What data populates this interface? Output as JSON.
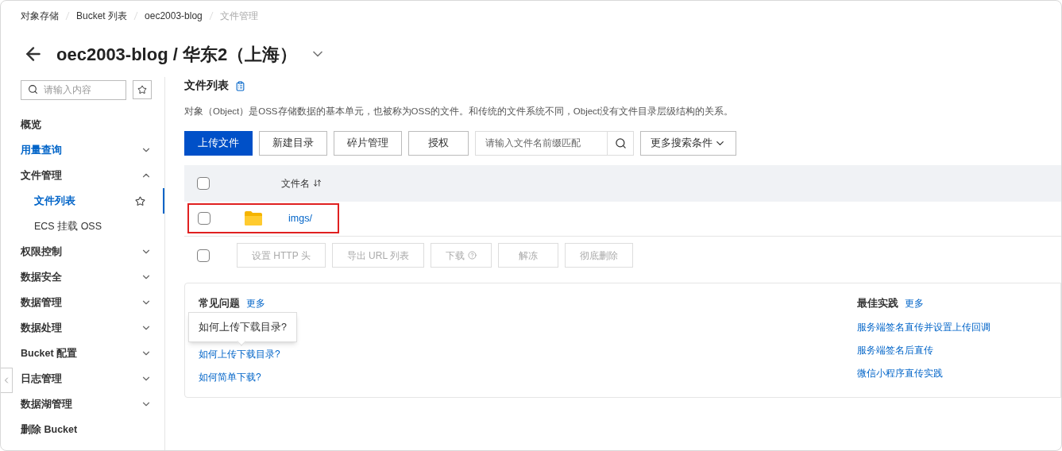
{
  "breadcrumb": [
    {
      "label": "对象存储",
      "current": false
    },
    {
      "label": "Bucket 列表",
      "current": false
    },
    {
      "label": "oec2003-blog",
      "current": false
    },
    {
      "label": "文件管理",
      "current": true
    }
  ],
  "page_title": "oec2003-blog / 华东2（上海）",
  "sidebar": {
    "search": {
      "placeholder": "请输入内容"
    },
    "items": [
      {
        "kind": "link",
        "label": "概览",
        "highlighted": false
      },
      {
        "kind": "group",
        "label": "用量查询",
        "highlighted": true,
        "expanded": false
      },
      {
        "kind": "group",
        "label": "文件管理",
        "highlighted": false,
        "expanded": true,
        "children": [
          {
            "label": "文件列表",
            "selected": true
          },
          {
            "label": "ECS 挂载 OSS",
            "selected": false
          }
        ]
      },
      {
        "kind": "group",
        "label": "权限控制",
        "highlighted": false,
        "expanded": false
      },
      {
        "kind": "group",
        "label": "数据安全",
        "highlighted": false,
        "expanded": false
      },
      {
        "kind": "group",
        "label": "数据管理",
        "highlighted": false,
        "expanded": false
      },
      {
        "kind": "group",
        "label": "数据处理",
        "highlighted": false,
        "expanded": false
      },
      {
        "kind": "group",
        "label": "Bucket 配置",
        "highlighted": false,
        "expanded": false
      },
      {
        "kind": "group",
        "label": "日志管理",
        "highlighted": false,
        "expanded": false
      },
      {
        "kind": "group",
        "label": "数据湖管理",
        "highlighted": false,
        "expanded": false
      },
      {
        "kind": "link",
        "label": "删除 Bucket",
        "highlighted": false
      }
    ]
  },
  "section": {
    "title": "文件列表",
    "description": "对象（Object）是OSS存储数据的基本单元，也被称为OSS的文件。和传统的文件系统不同，Object没有文件目录层级结构的关系。"
  },
  "toolbar": {
    "buttons": [
      {
        "label": "上传文件",
        "primary": true
      },
      {
        "label": "新建目录",
        "primary": false
      },
      {
        "label": "碎片管理",
        "primary": false
      },
      {
        "label": "授权",
        "primary": false
      }
    ],
    "search": {
      "placeholder": "请输入文件名前缀匹配"
    },
    "filter": "更多搜索条件"
  },
  "table": {
    "columns": [
      {
        "label": "文件名"
      }
    ],
    "header_checked": false,
    "rows": [
      {
        "kind": "folder",
        "name": "imgs/",
        "checked": false,
        "outlined": true
      }
    ],
    "bulk_checked": false,
    "bulk_actions": [
      {
        "label": "设置 HTTP 头",
        "disabled": true,
        "help": false
      },
      {
        "label": "导出 URL 列表",
        "disabled": true,
        "help": false
      },
      {
        "label": "下载",
        "disabled": true,
        "help": true
      },
      {
        "label": "解冻",
        "disabled": true,
        "help": false
      },
      {
        "label": "彻底删除",
        "disabled": true,
        "help": false
      }
    ]
  },
  "faq": {
    "title": "常见问题",
    "more": "更多",
    "tooltip": "如何上传下载目录?",
    "links": [
      "如何上传下载目录?",
      "如何简单下载?"
    ]
  },
  "best_practice": {
    "title": "最佳实践",
    "more": "更多",
    "links": [
      "服务端签名直传并设置上传回调",
      "服务端签名后直传",
      "微信小程序直传实践"
    ]
  }
}
